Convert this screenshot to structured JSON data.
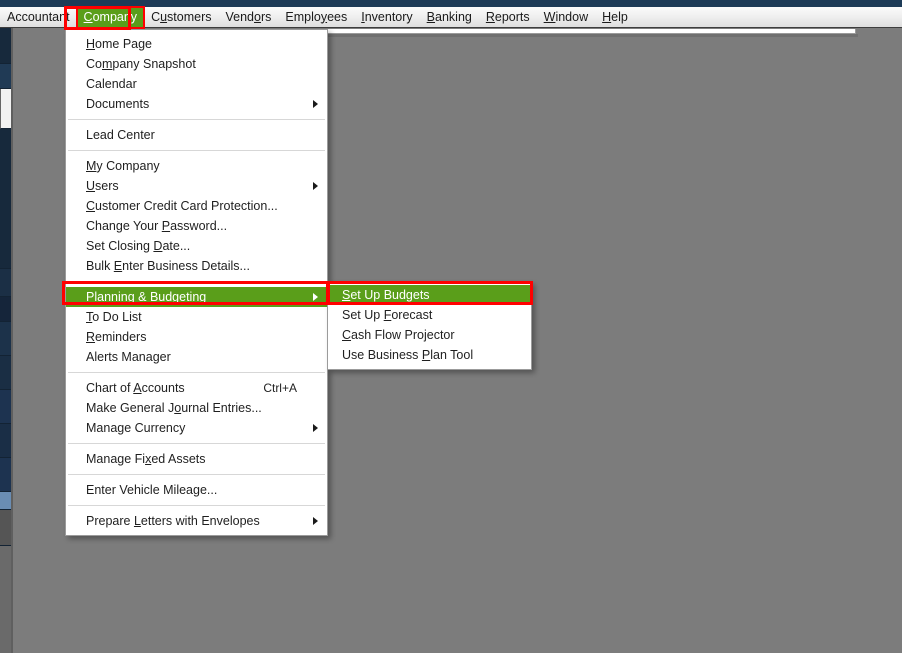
{
  "window": {
    "titlebar_color": "#1d3b57",
    "background_color": "#7c7c7c",
    "accent_green": "#5a9e1a",
    "highlight_red": "#ff0000"
  },
  "menubar": {
    "items": [
      {
        "label": "Accountant",
        "accel": "",
        "active": false,
        "highlighted": false
      },
      {
        "label": "Company",
        "accel": "C",
        "active": true,
        "highlighted": true
      },
      {
        "label": "Customers",
        "accel": "u",
        "active": false,
        "highlighted": false
      },
      {
        "label": "Vendors",
        "accel": "o",
        "active": false,
        "highlighted": false
      },
      {
        "label": "Employees",
        "accel": "y",
        "active": false,
        "highlighted": false
      },
      {
        "label": "Inventory",
        "accel": "I",
        "active": false,
        "highlighted": false
      },
      {
        "label": "Banking",
        "accel": "B",
        "active": false,
        "highlighted": false
      },
      {
        "label": "Reports",
        "accel": "R",
        "active": false,
        "highlighted": false
      },
      {
        "label": "Window",
        "accel": "W",
        "active": false,
        "highlighted": false
      },
      {
        "label": "Help",
        "accel": "H",
        "active": false,
        "highlighted": false
      }
    ]
  },
  "company_menu": {
    "name": "Company",
    "groups": [
      {
        "items": [
          {
            "label": "Home Page",
            "accel": "H",
            "accel_index": 0,
            "submenu": false,
            "shortcut": "",
            "selected": false
          },
          {
            "label": "Company Snapshot",
            "accel": "o",
            "accel_index": 2,
            "submenu": false,
            "shortcut": "",
            "selected": false
          },
          {
            "label": "Calendar",
            "accel": "",
            "accel_index": -1,
            "submenu": false,
            "shortcut": "",
            "selected": false
          },
          {
            "label": "Documents",
            "accel": "",
            "accel_index": -1,
            "submenu": true,
            "shortcut": "",
            "selected": false
          }
        ]
      },
      {
        "items": [
          {
            "label": "Lead Center",
            "accel": "",
            "accel_index": -1,
            "submenu": false,
            "shortcut": "",
            "selected": false
          }
        ]
      },
      {
        "items": [
          {
            "label": "My Company",
            "accel": "M",
            "accel_index": 0,
            "submenu": false,
            "shortcut": "",
            "selected": false
          },
          {
            "label": "Users",
            "accel": "U",
            "accel_index": 0,
            "submenu": true,
            "shortcut": "",
            "selected": false
          },
          {
            "label": "Customer Credit Card Protection...",
            "accel": "C",
            "accel_index": 0,
            "submenu": false,
            "shortcut": "",
            "selected": false
          },
          {
            "label": "Change Your Password...",
            "accel": "P",
            "accel_index": 12,
            "submenu": false,
            "shortcut": "",
            "selected": false
          },
          {
            "label": "Set Closing Date...",
            "accel": "D",
            "accel_index": 12,
            "submenu": false,
            "shortcut": "",
            "selected": false
          },
          {
            "label": "Bulk Enter Business Details...",
            "accel": "E",
            "accel_index": 5,
            "submenu": false,
            "shortcut": "",
            "selected": false
          }
        ]
      },
      {
        "items": [
          {
            "label": "Planning & Budgeting",
            "accel": "n",
            "accel_index": 6,
            "submenu": true,
            "shortcut": "",
            "selected": true
          },
          {
            "label": "To Do List",
            "accel": "T",
            "accel_index": 0,
            "submenu": false,
            "shortcut": "",
            "selected": false
          },
          {
            "label": "Reminders",
            "accel": "R",
            "accel_index": 0,
            "submenu": false,
            "shortcut": "",
            "selected": false
          },
          {
            "label": "Alerts Manager",
            "accel": "",
            "accel_index": -1,
            "submenu": false,
            "shortcut": "",
            "selected": false
          }
        ]
      },
      {
        "items": [
          {
            "label": "Chart of Accounts",
            "accel": "A",
            "accel_index": 9,
            "submenu": false,
            "shortcut": "Ctrl+A",
            "selected": false
          },
          {
            "label": "Make General Journal Entries...",
            "accel": "J",
            "accel_index": 14,
            "submenu": false,
            "shortcut": "",
            "selected": false
          },
          {
            "label": "Manage Currency",
            "accel": "",
            "accel_index": -1,
            "submenu": true,
            "shortcut": "",
            "selected": false
          }
        ]
      },
      {
        "items": [
          {
            "label": "Manage Fixed Assets",
            "accel": "x",
            "accel_index": 9,
            "submenu": false,
            "shortcut": "",
            "selected": false
          }
        ]
      },
      {
        "items": [
          {
            "label": "Enter Vehicle Mileage...",
            "accel": "",
            "accel_index": -1,
            "submenu": false,
            "shortcut": "",
            "selected": false
          }
        ]
      },
      {
        "items": [
          {
            "label": "Prepare Letters with Envelopes",
            "accel": "L",
            "accel_index": 8,
            "submenu": true,
            "shortcut": "",
            "selected": false
          }
        ]
      }
    ]
  },
  "planning_submenu": {
    "name": "Planning & Budgeting",
    "items": [
      {
        "label": "Set Up Budgets",
        "accel": "S",
        "accel_index": 0,
        "selected": true,
        "highlighted": true
      },
      {
        "label": "Set Up Forecast",
        "accel": "F",
        "accel_index": 7,
        "selected": false,
        "highlighted": false
      },
      {
        "label": "Cash Flow Projector",
        "accel": "C",
        "accel_index": 0,
        "selected": false,
        "highlighted": false
      },
      {
        "label": "Use Business Plan Tool",
        "accel": "P",
        "accel_index": 13,
        "selected": false,
        "highlighted": false
      }
    ]
  },
  "annotations": {
    "boxes": [
      {
        "target": "Company",
        "color": "#ff0000"
      },
      {
        "target": "Planning & Budgeting",
        "color": "#ff0000"
      },
      {
        "target": "Set Up Budgets",
        "color": "#ff0000"
      }
    ]
  }
}
